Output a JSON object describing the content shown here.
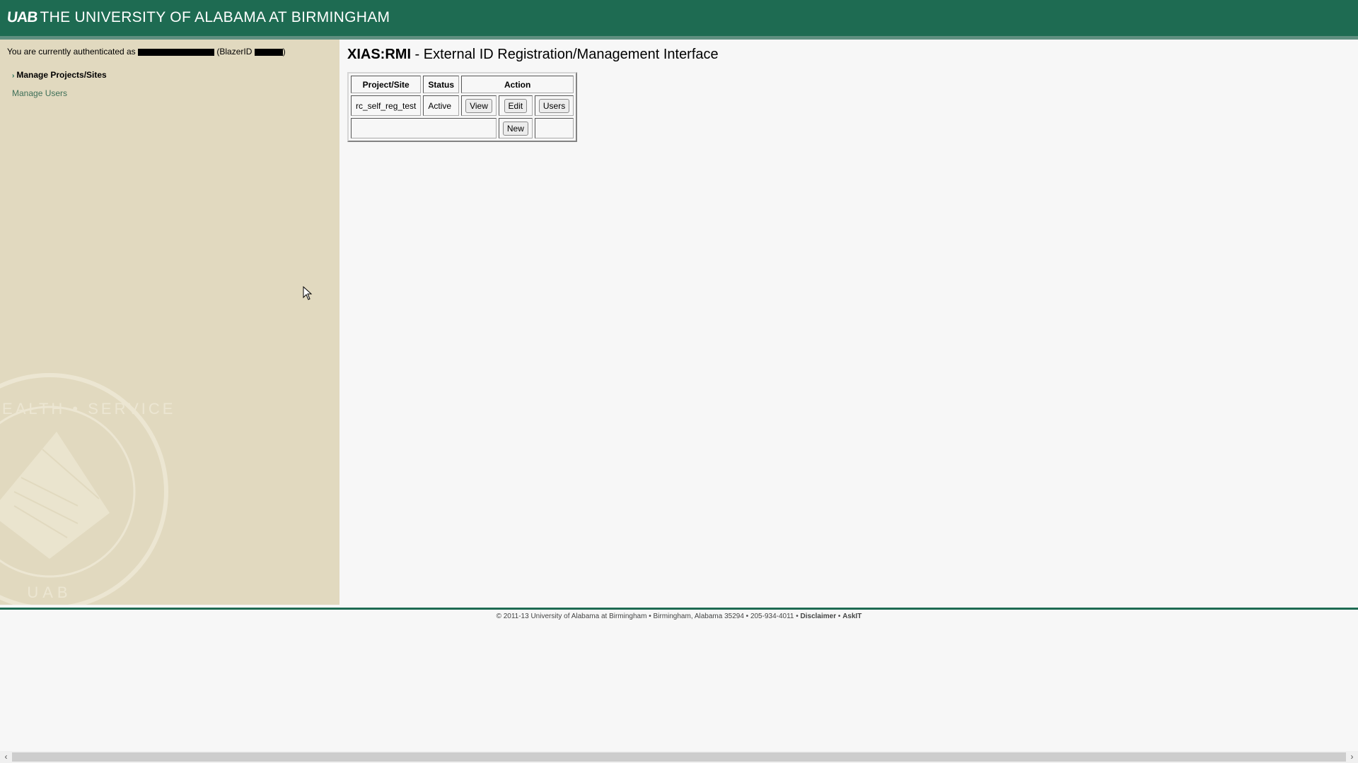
{
  "banner": {
    "logo": "UAB",
    "title": "THE UNIVERSITY OF ALABAMA AT BIRMINGHAM",
    "bg_color": "#1e6b52"
  },
  "sidebar": {
    "auth_prefix": "You are currently authenticated as",
    "blazer_prefix": "(BlazerID",
    "blazer_suffix": ")",
    "nav": [
      {
        "label": "Manage Projects/Sites",
        "active": true
      },
      {
        "label": "Manage Users",
        "active": false
      }
    ],
    "seal_text_top": "RCH • HEALTH • SERVICE",
    "seal_text_bottom": "UAB",
    "bg_color": "#e1d9bf"
  },
  "main": {
    "title_bold": "XIAS:RMI",
    "title_rest": " - External ID Registration/Management Interface",
    "table": {
      "headers": [
        "Project/Site",
        "Status",
        "Action"
      ],
      "rows": [
        {
          "project": "rc_self_reg_test",
          "status": "Active",
          "buttons": [
            "View",
            "Edit",
            "Users"
          ]
        }
      ],
      "new_button": "New"
    }
  },
  "footer": {
    "text": "© 2011-13 University of Alabama at Birmingham • Birmingham, Alabama 35294 • 205-934-4011 • ",
    "disclaimer": "Disclaimer",
    "sep": " • ",
    "askit": "AskIT"
  },
  "scrollbar": {
    "left_arrow": "‹",
    "right_arrow": "›"
  }
}
